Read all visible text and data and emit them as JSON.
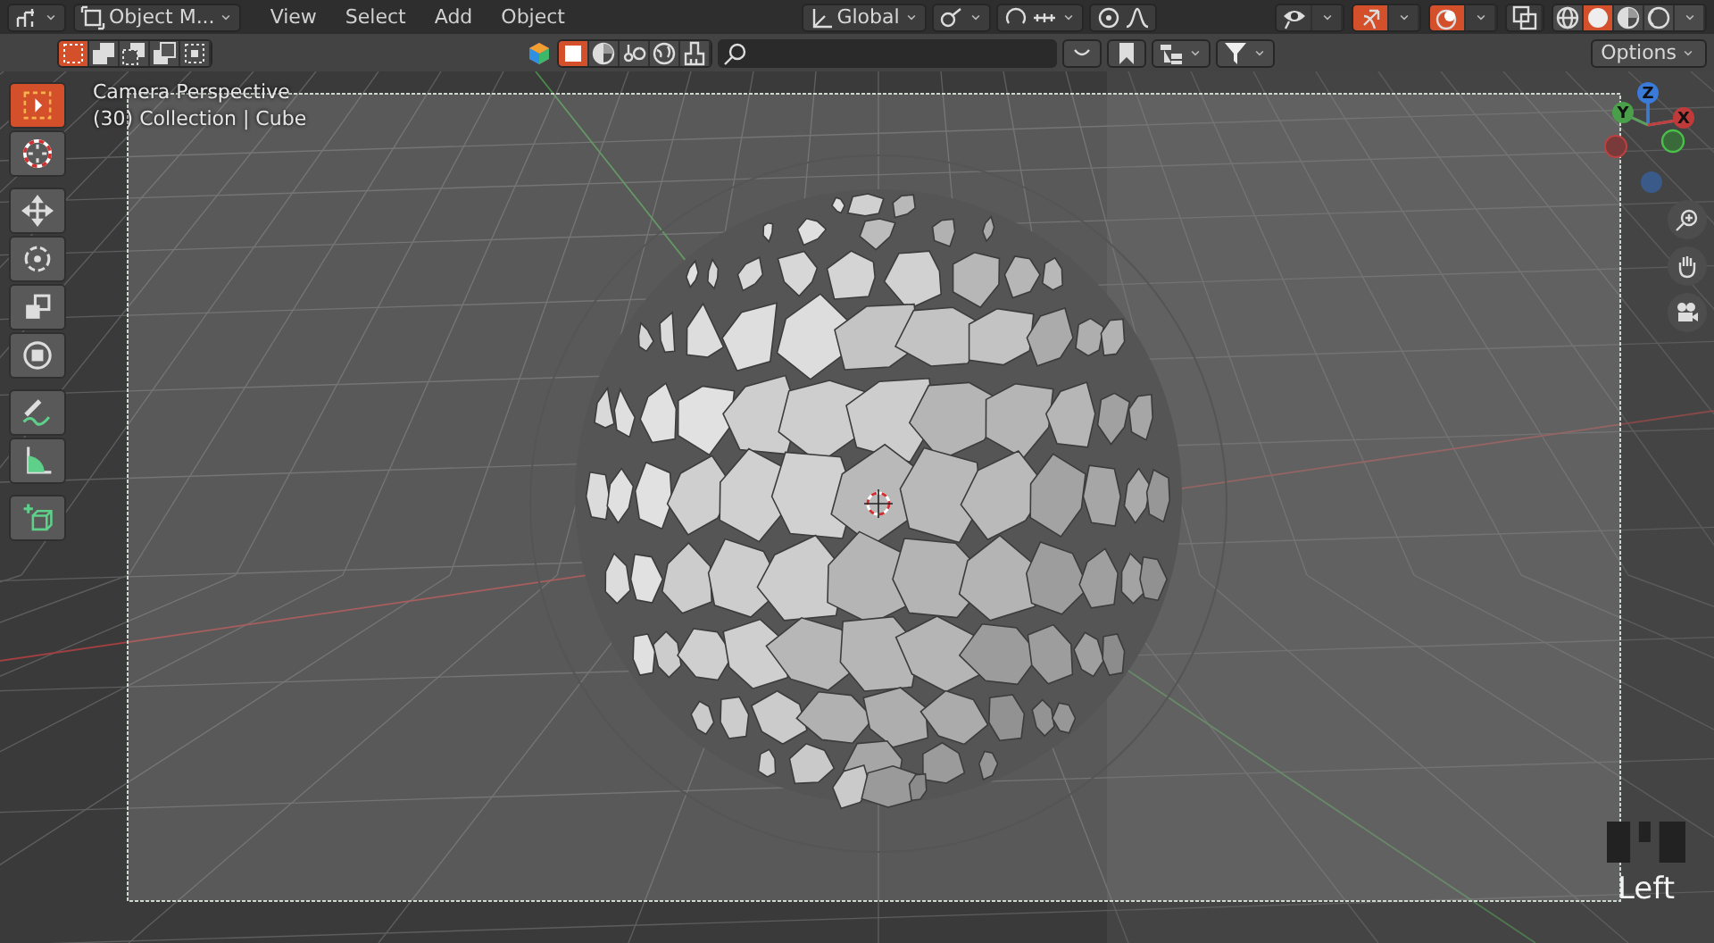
{
  "header": {
    "mode_menu": "Object M...",
    "menus": [
      "View",
      "Select",
      "Add",
      "Object"
    ],
    "orientation_menu": "Global",
    "overlay_toggles": [
      {
        "kind": "visibility",
        "on": false
      },
      {
        "kind": "gizmo",
        "on": true
      },
      {
        "kind": "overlays",
        "on": true
      },
      {
        "kind": "xray",
        "on": false
      }
    ],
    "shading_modes": [
      {
        "kind": "wireframe",
        "selected": false
      },
      {
        "kind": "solid",
        "selected": true
      },
      {
        "kind": "material",
        "selected": false
      },
      {
        "kind": "rendered",
        "selected": false
      }
    ]
  },
  "tool_settings": {
    "select_modes": [
      {
        "kind": "new",
        "selected": true
      },
      {
        "kind": "extend",
        "selected": false
      },
      {
        "kind": "subtract",
        "selected": false
      },
      {
        "kind": "invert",
        "selected": false
      },
      {
        "kind": "intersect",
        "selected": false
      }
    ],
    "object_filters": [
      {
        "kind": "mesh",
        "selected": true
      },
      {
        "kind": "material",
        "selected": false
      },
      {
        "kind": "light",
        "selected": false
      },
      {
        "kind": "world",
        "selected": false
      },
      {
        "kind": "brush",
        "selected": false
      }
    ],
    "options_button": "Options"
  },
  "tool_groups": [
    [
      {
        "kind": "select_box",
        "selected": true
      },
      {
        "kind": "cursor",
        "selected": false
      }
    ],
    [
      {
        "kind": "move",
        "selected": false
      },
      {
        "kind": "rotate",
        "selected": false
      },
      {
        "kind": "scale",
        "selected": false
      },
      {
        "kind": "transform",
        "selected": false
      }
    ],
    [
      {
        "kind": "annotate",
        "selected": false
      },
      {
        "kind": "measure",
        "selected": false
      }
    ],
    [
      {
        "kind": "add_cube",
        "selected": false
      }
    ]
  ],
  "viewport": {
    "view_name": "Camera Perspective",
    "object_info": "(30) Collection | Cube",
    "gizmo_axes": [
      "Z",
      "Y",
      "X"
    ],
    "camera_name": "Left"
  }
}
